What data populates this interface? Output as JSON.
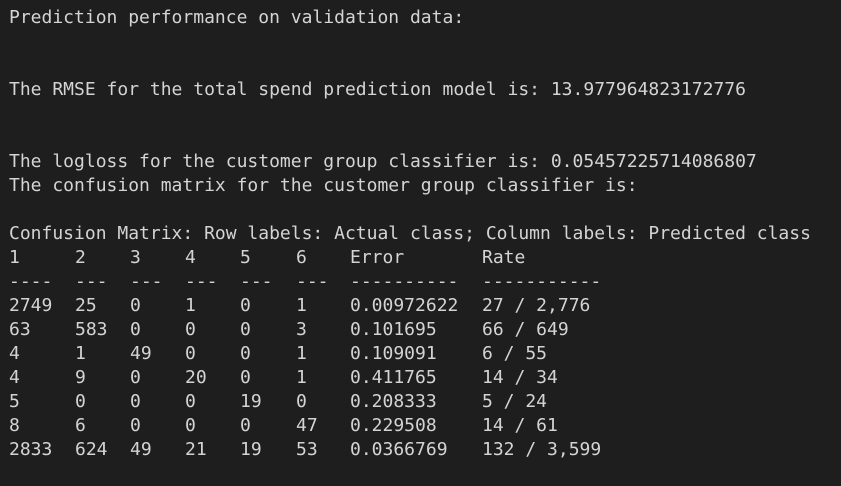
{
  "output": {
    "header": "Prediction performance on validation data:",
    "rmse_line": "The RMSE for the total spend prediction model is: 13.977964823172776",
    "logloss_line": "The logloss for the customer group classifier is: 0.05457225714086807",
    "cm_intro_line": "The confusion matrix for the customer group classifier is:",
    "cm_title": "Confusion Matrix: Row labels: Actual class; Column labels: Predicted class",
    "columns": [
      "1",
      "2",
      "3",
      "4",
      "5",
      "6",
      "Error",
      "Rate"
    ],
    "separators": [
      "----",
      "---",
      "---",
      "---",
      "---",
      "---",
      "----------",
      "-----------"
    ],
    "rows": [
      [
        "2749",
        "25",
        "0",
        "1",
        "0",
        "1",
        "0.00972622",
        "27 / 2,776"
      ],
      [
        "63",
        "583",
        "0",
        "0",
        "0",
        "3",
        "0.101695",
        "66 / 649"
      ],
      [
        "4",
        "1",
        "49",
        "0",
        "0",
        "1",
        "0.109091",
        "6 / 55"
      ],
      [
        "4",
        "9",
        "0",
        "20",
        "0",
        "1",
        "0.411765",
        "14 / 34"
      ],
      [
        "5",
        "0",
        "0",
        "0",
        "19",
        "0",
        "0.208333",
        "5 / 24"
      ],
      [
        "8",
        "6",
        "0",
        "0",
        "0",
        "47",
        "0.229508",
        "14 / 61"
      ],
      [
        "2833",
        "624",
        "49",
        "21",
        "19",
        "53",
        "0.0366769",
        "132 / 3,599"
      ]
    ]
  }
}
